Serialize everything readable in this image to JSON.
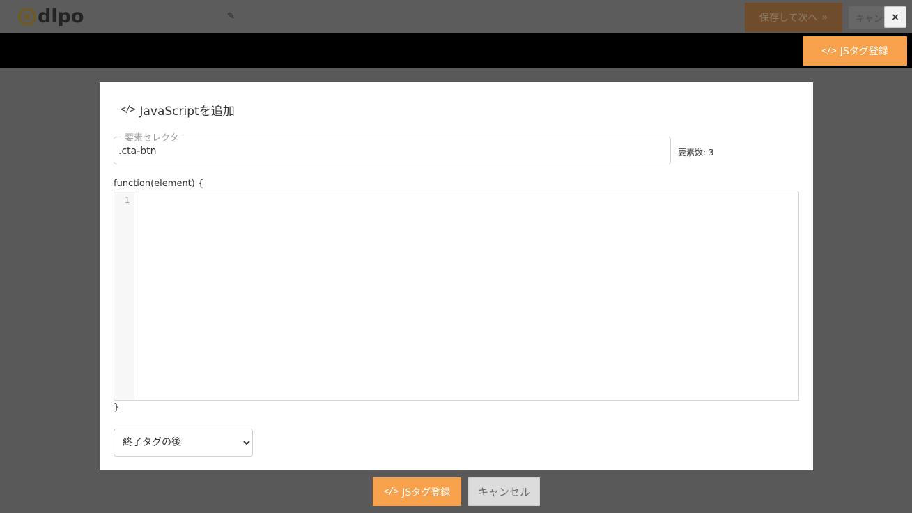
{
  "header": {
    "logo_text": "dlpo",
    "save_next_label": "保存して次へ",
    "save_next_icon": "»",
    "cancel_label": "キャンセル",
    "close_icon": "×"
  },
  "toolbar": {
    "js_tag_label": "JSタグ登録",
    "js_tag_icon": "</>"
  },
  "modal": {
    "title": "JavaScriptを追加",
    "title_icon": "</>",
    "selector": {
      "legend": "要素セレクタ",
      "value": ".cta-btn"
    },
    "element_count": "要素数: 3",
    "function_open": "function(element) {",
    "editor": {
      "line_numbers": [
        "1"
      ],
      "code": ""
    },
    "function_close": "}",
    "position_select": {
      "selected": "終了タグの後"
    }
  },
  "footer": {
    "register_label": "JSタグ登録",
    "register_icon": "</>",
    "cancel_label": "キャンセル"
  },
  "colors": {
    "accent_orange": "#f8a14c",
    "toolbar_black": "#000000",
    "overlay_gray": "#595959"
  }
}
